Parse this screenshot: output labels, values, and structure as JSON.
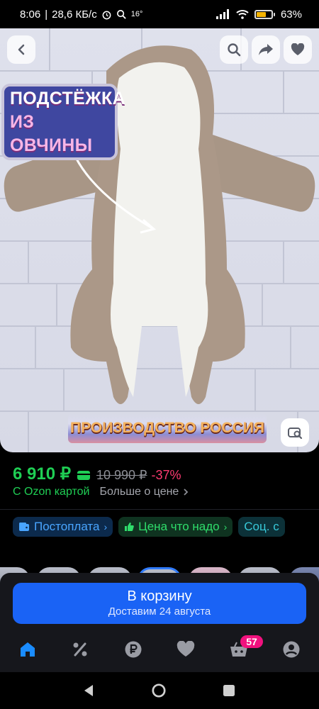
{
  "status_bar": {
    "time": "8:06",
    "network_speed": "28,6 КБ/с",
    "temperature": "16°",
    "battery": "63%",
    "battery_level": 0.63,
    "icons": [
      "alarm-icon",
      "search-icon",
      "signal-icon",
      "wifi-icon",
      "battery-icon"
    ]
  },
  "product_image": {
    "badge_line1": "ПОДСТЁЖКА",
    "badge_line2": "ИЗ ОВЧИНЫ",
    "made_in": "ПРОИЗВОДСТВО РОССИЯ",
    "buttons": [
      "back-icon",
      "search-icon",
      "share-icon",
      "heart-icon",
      "visual-search-icon"
    ]
  },
  "price": {
    "current": "6 910 ₽",
    "old": "10 990 ₽",
    "discount": "-37%",
    "ozon_card": "С Ozon картой",
    "more_price": "Больше о цене"
  },
  "chips": [
    {
      "label": "Постоплата",
      "icon": "wallet-icon"
    },
    {
      "label": "Цена что надо",
      "icon": "thumbs-up-icon"
    },
    {
      "label": "Соц. с"
    }
  ],
  "cart": {
    "label": "В корзину",
    "delivery": "Доставим 24 августа"
  },
  "bottom_nav": {
    "items": [
      "home-icon",
      "percent-icon",
      "ruble-icon",
      "heart-icon",
      "cart-icon",
      "profile-icon"
    ],
    "cart_count": "57"
  },
  "colors": {
    "accent_blue": "#1a63f5",
    "price_green": "#1fce54",
    "discount_pink": "#ff3b72",
    "badge_pink": "#f1117e"
  }
}
